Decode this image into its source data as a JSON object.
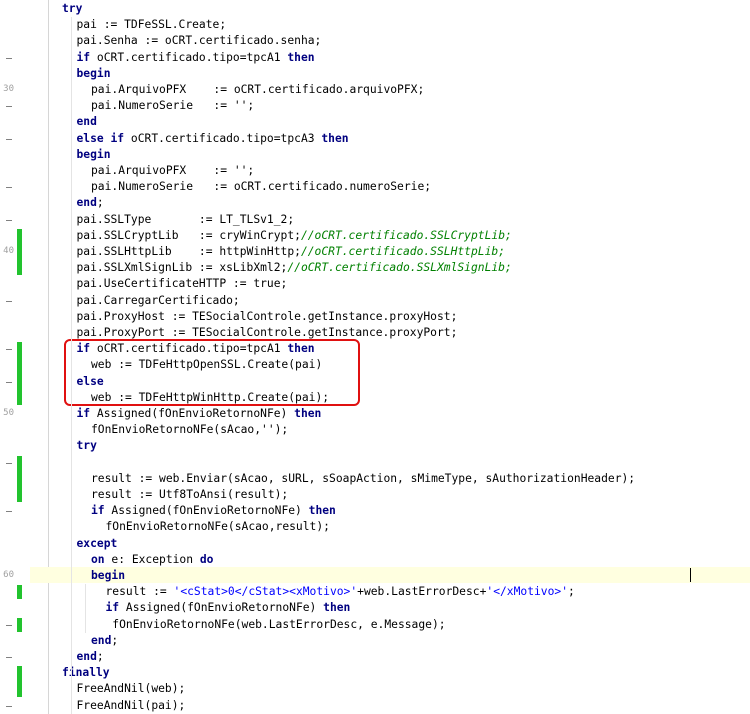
{
  "colors": {
    "keyword": "#000080",
    "comment": "#008000",
    "string": "#0000ff",
    "modified_bar": "#22c32e",
    "highlight_box": "#e01010",
    "current_line": "#ffffe0"
  },
  "gutter": {
    "line_numbers": [
      {
        "label": "30",
        "row": 5
      },
      {
        "label": "40",
        "row": 15
      },
      {
        "label": "50",
        "row": 25
      },
      {
        "label": "60",
        "row": 35
      }
    ]
  },
  "code_lines": [
    {
      "indent": 0,
      "tokens": [
        {
          "t": "kw",
          "v": "try"
        }
      ]
    },
    {
      "indent": 1,
      "tokens": [
        {
          "t": "tx",
          "v": "pai := TDFeSSL.Create;"
        }
      ]
    },
    {
      "indent": 1,
      "tokens": [
        {
          "t": "tx",
          "v": "pai.Senha := oCRT.certificado.senha;"
        }
      ]
    },
    {
      "indent": 1,
      "tokens": [
        {
          "t": "kw",
          "v": "if"
        },
        {
          "t": "tx",
          "v": " oCRT.certificado.tipo=tpcA1 "
        },
        {
          "t": "kw",
          "v": "then"
        }
      ]
    },
    {
      "indent": 1,
      "tokens": [
        {
          "t": "kw",
          "v": "begin"
        }
      ]
    },
    {
      "indent": 2,
      "tokens": [
        {
          "t": "tx",
          "v": "pai.ArquivoPFX    := oCRT.certificado.arquivoPFX;"
        }
      ]
    },
    {
      "indent": 2,
      "tokens": [
        {
          "t": "tx",
          "v": "pai.NumeroSerie   := '';"
        }
      ]
    },
    {
      "indent": 1,
      "tokens": [
        {
          "t": "kw",
          "v": "end"
        }
      ]
    },
    {
      "indent": 1,
      "tokens": [
        {
          "t": "kw",
          "v": "else if"
        },
        {
          "t": "tx",
          "v": " oCRT.certificado.tipo=tpcA3 "
        },
        {
          "t": "kw",
          "v": "then"
        }
      ]
    },
    {
      "indent": 1,
      "tokens": [
        {
          "t": "kw",
          "v": "begin"
        }
      ]
    },
    {
      "indent": 2,
      "tokens": [
        {
          "t": "tx",
          "v": "pai.ArquivoPFX    := '';"
        }
      ]
    },
    {
      "indent": 2,
      "tokens": [
        {
          "t": "tx",
          "v": "pai.NumeroSerie   := oCRT.certificado.numeroSerie;"
        }
      ]
    },
    {
      "indent": 1,
      "tokens": [
        {
          "t": "kw",
          "v": "end"
        },
        {
          "t": "tx",
          "v": ";"
        }
      ]
    },
    {
      "indent": 1,
      "tokens": [
        {
          "t": "tx",
          "v": "pai.SSLType       := LT_TLSv1_2;"
        }
      ]
    },
    {
      "indent": 1,
      "tokens": [
        {
          "t": "tx",
          "v": "pai.SSLCryptLib   := cryWinCrypt;"
        },
        {
          "t": "cm",
          "v": "//oCRT.certificado.SSLCryptLib;"
        }
      ]
    },
    {
      "indent": 1,
      "tokens": [
        {
          "t": "tx",
          "v": "pai.SSLHttpLib    := httpWinHttp;"
        },
        {
          "t": "cm",
          "v": "//oCRT.certificado.SSLHttpLib;"
        }
      ]
    },
    {
      "indent": 1,
      "tokens": [
        {
          "t": "tx",
          "v": "pai.SSLXmlSignLib := xsLibXml2;"
        },
        {
          "t": "cm",
          "v": "//oCRT.certificado.SSLXmlSignLib;"
        }
      ]
    },
    {
      "indent": 1,
      "tokens": [
        {
          "t": "tx",
          "v": "pai.UseCertificateHTTP := true;"
        }
      ]
    },
    {
      "indent": 1,
      "tokens": [
        {
          "t": "tx",
          "v": "pai.CarregarCertificado;"
        }
      ]
    },
    {
      "indent": 1,
      "tokens": [
        {
          "t": "tx",
          "v": "pai.ProxyHost := TESocialControle.getInstance.proxyHost;"
        }
      ]
    },
    {
      "indent": 1,
      "tokens": [
        {
          "t": "tx",
          "v": "pai.ProxyPort := TESocialControle.getInstance.proxyPort;"
        }
      ]
    },
    {
      "indent": 1,
      "tokens": [
        {
          "t": "kw",
          "v": "if"
        },
        {
          "t": "tx",
          "v": " oCRT.certificado.tipo=tpcA1 "
        },
        {
          "t": "kw",
          "v": "then"
        }
      ]
    },
    {
      "indent": 2,
      "tokens": [
        {
          "t": "tx",
          "v": "web := TDFeHttpOpenSSL.Create(pai)"
        }
      ]
    },
    {
      "indent": 1,
      "tokens": [
        {
          "t": "kw",
          "v": "else"
        }
      ]
    },
    {
      "indent": 2,
      "tokens": [
        {
          "t": "tx",
          "v": "web := TDFeHttpWinHttp.Create(pai);"
        }
      ]
    },
    {
      "indent": 1,
      "tokens": [
        {
          "t": "kw",
          "v": "if"
        },
        {
          "t": "tx",
          "v": " Assigned(fOnEnvioRetornoNFe) "
        },
        {
          "t": "kw",
          "v": "then"
        }
      ]
    },
    {
      "indent": 2,
      "tokens": [
        {
          "t": "tx",
          "v": "fOnEnvioRetornoNFe(sAcao,'');"
        }
      ]
    },
    {
      "indent": 1,
      "tokens": [
        {
          "t": "kw",
          "v": "try"
        }
      ]
    },
    {
      "indent": 0,
      "tokens": []
    },
    {
      "indent": 2,
      "tokens": [
        {
          "t": "tx",
          "v": "result := web.Enviar(sAcao, sURL, sSoapAction, sMimeType, sAuthorizationHeader);"
        }
      ]
    },
    {
      "indent": 2,
      "tokens": [
        {
          "t": "tx",
          "v": "result := Utf8ToAnsi(result);"
        }
      ]
    },
    {
      "indent": 2,
      "tokens": [
        {
          "t": "kw",
          "v": "if"
        },
        {
          "t": "tx",
          "v": " Assigned(fOnEnvioRetornoNFe) "
        },
        {
          "t": "kw",
          "v": "then"
        }
      ]
    },
    {
      "indent": 3,
      "tokens": [
        {
          "t": "tx",
          "v": "fOnEnvioRetornoNFe(sAcao,result);"
        }
      ]
    },
    {
      "indent": 1,
      "tokens": [
        {
          "t": "kw",
          "v": "except"
        }
      ]
    },
    {
      "indent": 2,
      "tokens": [
        {
          "t": "kw",
          "v": "on"
        },
        {
          "t": "tx",
          "v": " e: Exception "
        },
        {
          "t": "kw",
          "v": "do"
        }
      ]
    },
    {
      "indent": 2,
      "tokens": [
        {
          "t": "kw",
          "v": "begin"
        }
      ]
    },
    {
      "indent": 3,
      "tokens": [
        {
          "t": "tx",
          "v": "result := "
        },
        {
          "t": "st",
          "v": "'<cStat>0</cStat><xMotivo>'"
        },
        {
          "t": "tx",
          "v": "+web.LastErrorDesc+"
        },
        {
          "t": "st",
          "v": "'</xMotivo>'"
        },
        {
          "t": "tx",
          "v": ";"
        }
      ]
    },
    {
      "indent": 3,
      "tokens": [
        {
          "t": "kw",
          "v": "if"
        },
        {
          "t": "tx",
          "v": " Assigned(fOnEnvioRetornoNFe) "
        },
        {
          "t": "kw",
          "v": "then"
        }
      ]
    },
    {
      "indent": 3,
      "tokens": [
        {
          "t": "tx",
          "v": " fOnEnvioRetornoNFe(web.LastErrorDesc, e.Message);"
        }
      ]
    },
    {
      "indent": 2,
      "tokens": [
        {
          "t": "kw",
          "v": "end"
        },
        {
          "t": "tx",
          "v": ";"
        }
      ]
    },
    {
      "indent": 1,
      "tokens": [
        {
          "t": "kw",
          "v": "end"
        },
        {
          "t": "tx",
          "v": ";"
        }
      ]
    },
    {
      "indent": 0,
      "tokens": [
        {
          "t": "kw",
          "v": "finally"
        }
      ]
    },
    {
      "indent": 1,
      "tokens": [
        {
          "t": "tx",
          "v": "FreeAndNil(web);"
        }
      ]
    },
    {
      "indent": 1,
      "tokens": [
        {
          "t": "tx",
          "v": "FreeAndNil(pai);"
        }
      ]
    }
  ]
}
